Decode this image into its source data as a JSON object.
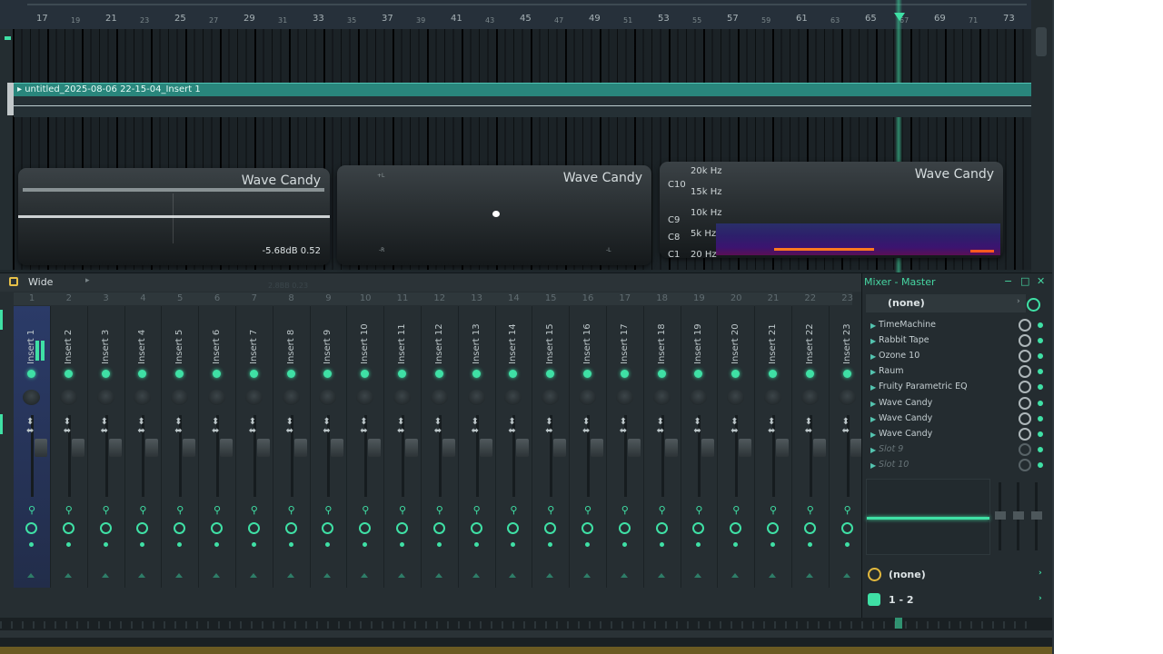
{
  "ruler": {
    "major": [
      "17",
      "21",
      "25",
      "29",
      "33",
      "37",
      "41",
      "45",
      "49",
      "53",
      "57",
      "61",
      "65",
      "69",
      "73"
    ],
    "minor": [
      "19",
      "23",
      "27",
      "31",
      "35",
      "39",
      "43",
      "47",
      "51",
      "55",
      "59",
      "63",
      "67",
      "71"
    ]
  },
  "playlist": {
    "clip_name": "untitled_2025-08-06 22-15-04_Insert 1"
  },
  "wave_candy": {
    "panel1": {
      "title": "Wave Candy",
      "readout": "-5.68dB  0.52"
    },
    "panel2": {
      "title": "Wave Candy",
      "label_top": "+L",
      "label_left": "-R",
      "label_right": "-L"
    },
    "panel3": {
      "title": "Wave Candy",
      "freq_labels": [
        "20k Hz",
        "15k Hz",
        "10k Hz",
        "5k Hz",
        "20 Hz"
      ],
      "note_labels": [
        "C10",
        "C9",
        "C8",
        "C1"
      ]
    }
  },
  "mixer": {
    "preset": "Wide",
    "faint_value": "2.8BB  0.23",
    "track_numbers": [
      "1",
      "2",
      "3",
      "4",
      "5",
      "6",
      "7",
      "8",
      "9",
      "10",
      "11",
      "12",
      "13",
      "14",
      "15",
      "16",
      "17",
      "18",
      "19",
      "20",
      "21",
      "22",
      "23"
    ],
    "inserts": [
      "Insert 1",
      "Insert 2",
      "Insert 3",
      "Insert 4",
      "Insert 5",
      "Insert 6",
      "Insert 7",
      "Insert 8",
      "Insert 9",
      "Insert 10",
      "Insert 11",
      "Insert 12",
      "Insert 13",
      "Insert 14",
      "Insert 15",
      "Insert 16",
      "Insert 17",
      "Insert 18",
      "Insert 19",
      "Insert 20",
      "Insert 21",
      "Insert 22",
      "Insert 23"
    ]
  },
  "master": {
    "title": "Mixer - Master",
    "minimize": "−",
    "maximize": "□",
    "close": "✕",
    "input": "(none)",
    "slots": [
      "TimeMachine",
      "Rabbit Tape",
      "Ozone 10",
      "Raum",
      "Fruity Parametric EQ",
      "Wave Candy",
      "Wave Candy",
      "Wave Candy",
      "Slot 9",
      "Slot 10"
    ],
    "sidechain": "(none)",
    "output": "1 - 2"
  },
  "colors": {
    "accent": "#3fe0a5",
    "yellow": "#e3b93d"
  }
}
